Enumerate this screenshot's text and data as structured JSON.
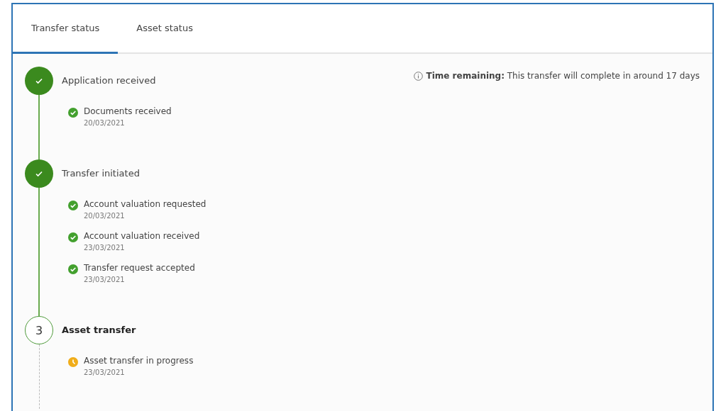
{
  "tabs": [
    {
      "label": "Transfer status",
      "selected": true
    },
    {
      "label": "Asset status",
      "selected": false
    }
  ],
  "notice": {
    "text": "**Time remaining:** This transfer will complete in around 17 days"
  },
  "stages": [
    {
      "title": "Application received",
      "kind": "complete",
      "items": [
        {
          "label": "Documents received",
          "date": "20/03/2021",
          "kind": "done"
        }
      ]
    },
    {
      "title": "Transfer initiated",
      "kind": "complete",
      "items": [
        {
          "label": "Account valuation requested",
          "date": "20/03/2021",
          "kind": "done"
        },
        {
          "label": "Account valuation received",
          "date": "23/03/2021",
          "kind": "done"
        },
        {
          "label": "Transfer request accepted",
          "date": "23/03/2021",
          "kind": "done"
        }
      ]
    },
    {
      "title": "Asset transfer",
      "kind": "current",
      "number": "3",
      "items": [
        {
          "label": "Asset transfer in progress",
          "date": "23/03/2021",
          "kind": "in_progress"
        }
      ]
    }
  ]
}
